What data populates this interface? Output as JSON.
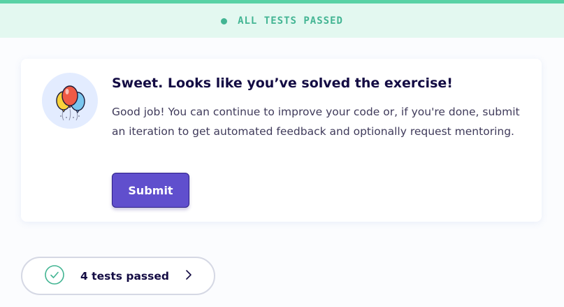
{
  "status": {
    "text": "ALL TESTS PASSED",
    "color": "#43b593",
    "background": "#e3f8f0",
    "icon": "status-dot-icon"
  },
  "success_card": {
    "icon": "balloons-icon",
    "title": "Sweet. Looks like you’ve solved the exercise!",
    "body": "Good job! You can continue to improve your code or, if you're done, submit an iteration to get automated feedback and optionally request mentoring.",
    "submit_label": "Submit",
    "button_color": "#604fcd"
  },
  "tests_summary": {
    "label": "4 tests passed",
    "check_icon": "check-circle-icon",
    "chevron_icon": "chevron-right-icon"
  }
}
